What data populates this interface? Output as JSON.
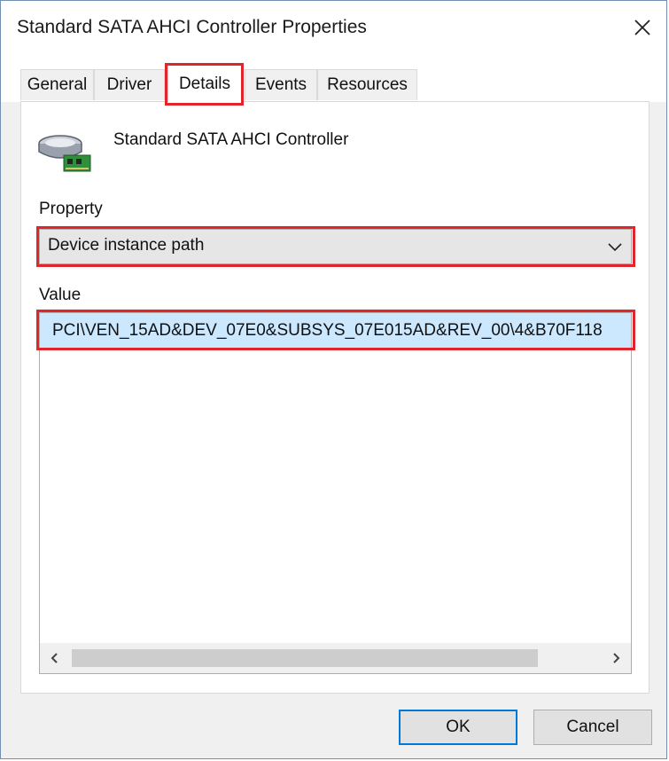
{
  "window": {
    "title": "Standard SATA AHCI Controller Properties",
    "close_icon": "close-icon"
  },
  "tabs": [
    {
      "label": "General",
      "active": false
    },
    {
      "label": "Driver",
      "active": false
    },
    {
      "label": "Details",
      "active": true
    },
    {
      "label": "Events",
      "active": false
    },
    {
      "label": "Resources",
      "active": false
    }
  ],
  "device": {
    "icon": "storage-controller-icon",
    "name": "Standard SATA AHCI Controller"
  },
  "property": {
    "label": "Property",
    "selected": "Device instance path"
  },
  "value": {
    "label": "Value",
    "items": [
      "PCI\\VEN_15AD&DEV_07E0&SUBSYS_07E015AD&REV_00\\4&B70F118"
    ]
  },
  "buttons": {
    "ok": "OK",
    "cancel": "Cancel"
  },
  "colors": {
    "highlight": "#e0262c",
    "selection": "#cce8ff",
    "accent": "#0078d7"
  }
}
